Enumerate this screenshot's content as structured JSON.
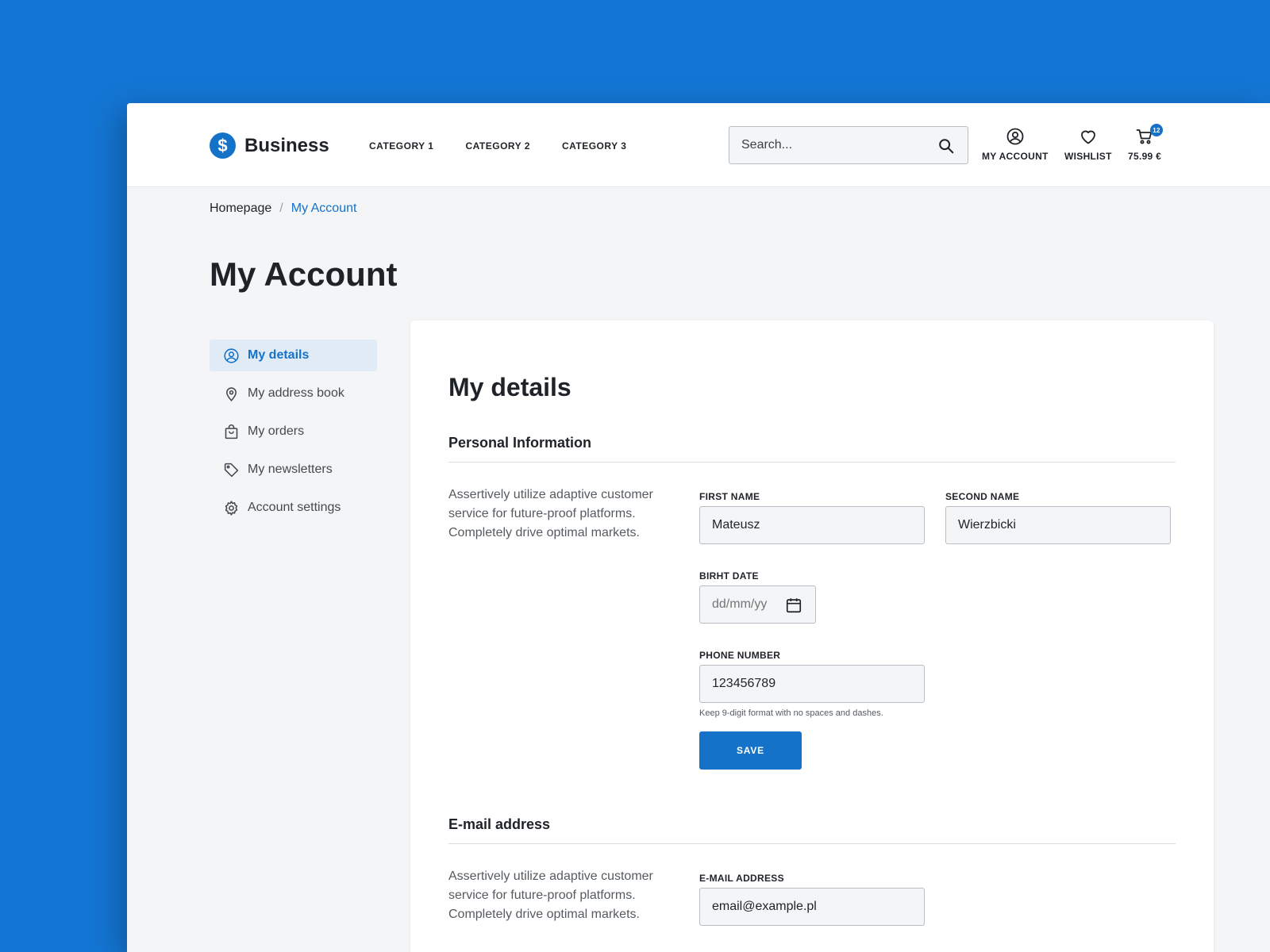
{
  "header": {
    "logo_symbol": "$",
    "logo_text": "Business",
    "nav": [
      "CATEGORY 1",
      "CATEGORY 2",
      "CATEGORY 3"
    ],
    "search_placeholder": "Search...",
    "account_label": "MY ACCOUNT",
    "wishlist_label": "WISHLIST",
    "cart_total": "75.99 €",
    "cart_count": "12"
  },
  "breadcrumb": {
    "home": "Homepage",
    "separator": "/",
    "current": "My Account"
  },
  "page_title": "My Account",
  "sidebar": {
    "items": [
      {
        "label": "My details",
        "icon": "user-circle-icon",
        "active": true
      },
      {
        "label": "My address book",
        "icon": "map-pin-icon",
        "active": false
      },
      {
        "label": "My orders",
        "icon": "shopping-bag-icon",
        "active": false
      },
      {
        "label": "My newsletters",
        "icon": "tag-icon",
        "active": false
      },
      {
        "label": "Account settings",
        "icon": "gear-icon",
        "active": false
      }
    ]
  },
  "details": {
    "title": "My details",
    "personal": {
      "title": "Personal Information",
      "description": "Assertively utilize adaptive customer service for future-proof platforms. Completely drive optimal markets.",
      "first_name_label": "FIRST NAME",
      "first_name_value": "Mateusz",
      "second_name_label": "SECOND NAME",
      "second_name_value": "Wierzbicki",
      "birth_date_label": "BIRHT DATE",
      "birth_date_placeholder": "dd/mm/yy",
      "phone_label": "PHONE NUMBER",
      "phone_value": "123456789",
      "phone_helper": "Keep 9-digit format with no spaces and dashes.",
      "save_label": "SAVE"
    },
    "email": {
      "title": "E-mail address",
      "description": "Assertively utilize adaptive customer service for future-proof platforms. Completely drive optimal markets.",
      "email_label": "E-MAIL ADDRESS",
      "email_value": "email@example.pl"
    }
  },
  "colors": {
    "accent": "#1572c9",
    "background": "#1476d4",
    "page": "#f3f5f7"
  }
}
